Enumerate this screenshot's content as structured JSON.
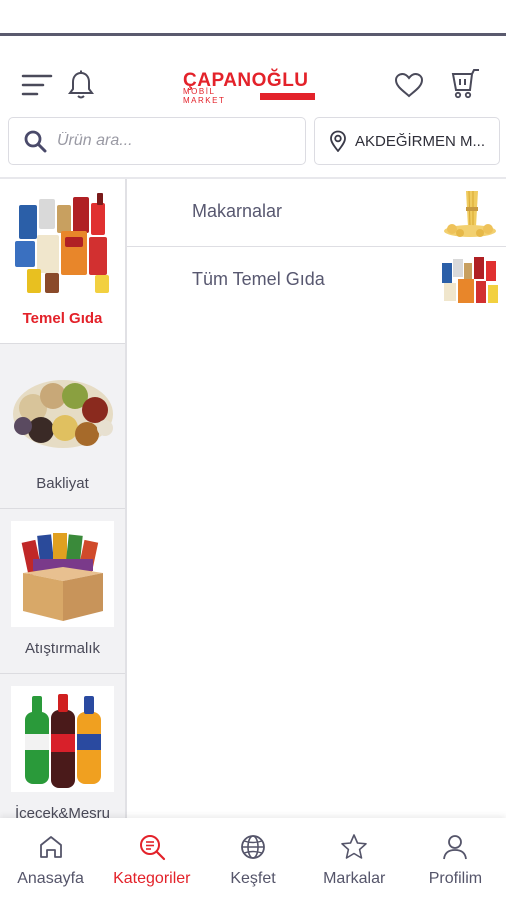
{
  "header": {
    "logo_main": "ÇAPANOĞLU",
    "logo_sub": "MOBİL MARKET",
    "menu_icon": "menu-icon",
    "notification_icon": "bell-icon",
    "favorites_icon": "heart-icon",
    "cart_icon": "cart-icon"
  },
  "search": {
    "placeholder": "Ürün ara...",
    "value": ""
  },
  "location": {
    "label": "AKDEĞİRMEN M...",
    "icon": "location-pin-icon"
  },
  "categories": [
    {
      "label": "Temel Gıda",
      "active": true,
      "image": "grocery-products-image"
    },
    {
      "label": "Bakliyat",
      "active": false,
      "image": "legumes-image"
    },
    {
      "label": "Atıştırmalık",
      "active": false,
      "image": "snacks-box-image"
    },
    {
      "label": "İçecek&Meşru",
      "active": false,
      "image": "soft-drinks-image"
    }
  ],
  "subcategories": [
    {
      "label": "Makarnalar",
      "image": "pasta-image"
    },
    {
      "label": "Tüm Temel Gıda",
      "image": "grocery-products-image"
    }
  ],
  "bottom_nav": [
    {
      "label": "Anasayfa",
      "icon": "home-icon",
      "active": false
    },
    {
      "label": "Kategoriler",
      "icon": "categories-search-icon",
      "active": true
    },
    {
      "label": "Keşfet",
      "icon": "globe-icon",
      "active": false
    },
    {
      "label": "Markalar",
      "icon": "star-icon",
      "active": false
    },
    {
      "label": "Profilim",
      "icon": "user-icon",
      "active": false
    }
  ],
  "colors": {
    "brand": "#e3222a",
    "text": "#585870",
    "sidebar_bg": "#f2f2f4"
  }
}
